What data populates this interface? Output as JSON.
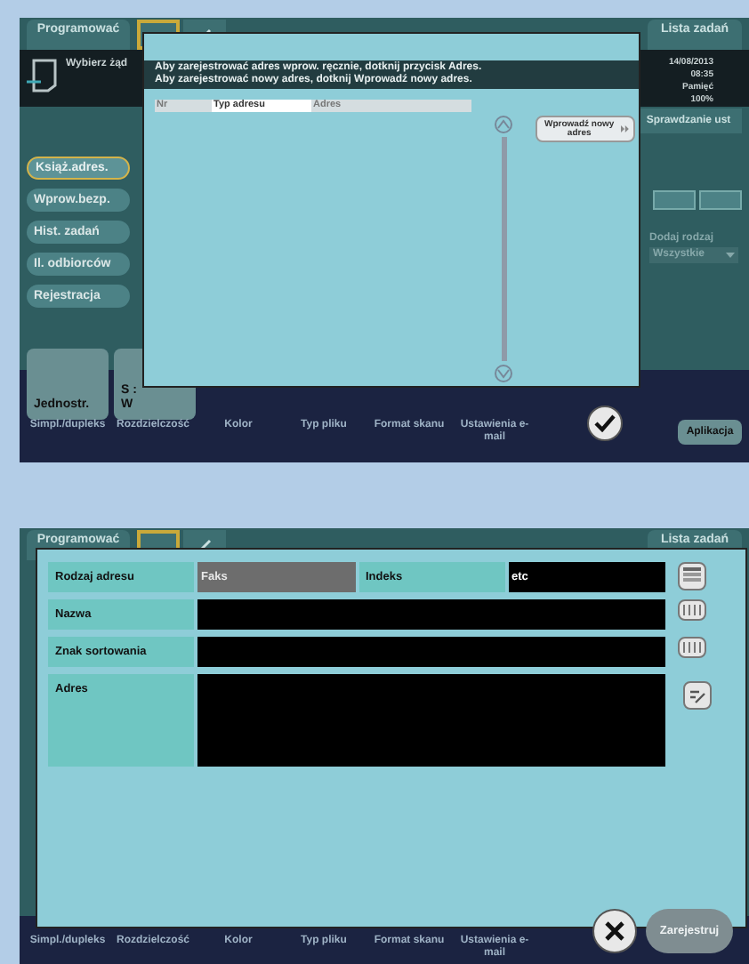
{
  "screen_1": {
    "top_bar": {
      "program_button": "Programować",
      "job_list_button": "Lista zadań"
    },
    "status": {
      "prompt": "Wybierz żąd",
      "date": "14/08/2013",
      "time": "08:35",
      "memory_label": "Pamięć",
      "memory_value": "100%"
    },
    "check_settings_button": "Sprawdzanie ust",
    "side_tabs": [
      {
        "label": "Książ.adres.",
        "selected": true
      },
      {
        "label": "Wprow.bezp.",
        "selected": false
      },
      {
        "label": "Hist. zadań",
        "selected": false
      },
      {
        "label": "Il. odbiorców",
        "selected": false
      },
      {
        "label": "Rejestracja",
        "selected": false
      }
    ],
    "filter": {
      "label": "Dodaj rodzaj",
      "value": "Wszystkie"
    },
    "function_tiles": [
      {
        "lines": [
          "Jednostr."
        ]
      },
      {
        "lines": [
          "S :",
          "W"
        ]
      }
    ],
    "bottom_labels": [
      "Simpl./dupleks",
      "Rozdzielczość",
      "Kolor",
      "Typ pliku",
      "Format skanu",
      "Ustawienia e-mail"
    ],
    "app_button": "Aplikacja",
    "dialog": {
      "message": [
        "Aby zarejestrować adres wprow. ręcznie, dotknij przycisk Adres.",
        "Aby zarejestrować nowy adres, dotknij Wprowadź nowy adres."
      ],
      "columns": [
        {
          "label": "Nr",
          "selected": false
        },
        {
          "label": "Typ adresu",
          "selected": true
        },
        {
          "label": "Adres",
          "selected": false
        }
      ],
      "new_address_button": "Wprowadź nowy adres"
    }
  },
  "screen_2": {
    "top_bar": {
      "program_button": "Programować",
      "job_list_button": "Lista zadań"
    },
    "bottom_labels": [
      "Simpl./dupleks",
      "Rozdzielczość",
      "Kolor",
      "Typ pliku",
      "Format skanu",
      "Ustawienia e-mail"
    ],
    "dialog": {
      "rows": [
        {
          "fields": [
            {
              "label": "Rodzaj adresu",
              "value": "Faks",
              "disabled": true
            },
            {
              "label": "Indeks",
              "value": "etc",
              "disabled": false
            }
          ],
          "kind": "list"
        },
        {
          "fields": [
            {
              "label": "Nazwa",
              "disabled": false
            }
          ],
          "kind": "keyboard"
        },
        {
          "fields": [
            {
              "label": "Znak sortowania",
              "disabled": false
            }
          ],
          "kind": "keyboard"
        },
        {
          "fields": [
            {
              "label": "Adres",
              "disabled": false
            }
          ],
          "kind": "edit"
        }
      ],
      "register_button": {
        "label": "Zarejestruj",
        "disabled": true
      }
    }
  }
}
